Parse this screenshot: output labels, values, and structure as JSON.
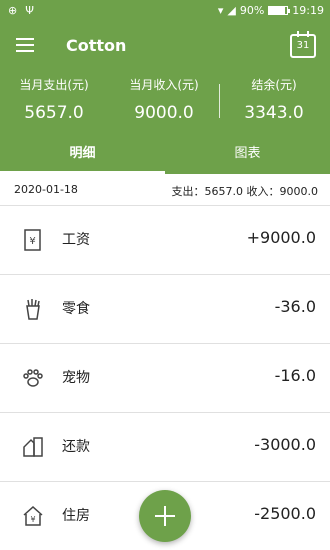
{
  "status": {
    "battery": "90%",
    "time": "19:19",
    "battery_level": 0.9
  },
  "app": {
    "title": "Cotton",
    "calendar_day": "31"
  },
  "summary": {
    "expense_label": "当月支出(元)",
    "expense_value": "5657.0",
    "income_label": "当月收入(元)",
    "income_value": "9000.0",
    "balance_label": "结余(元)",
    "balance_value": "3343.0"
  },
  "tabs": [
    "明细",
    "图表"
  ],
  "day": {
    "date": "2020-01-18",
    "totals": "支出：5657.0 收入：9000.0"
  },
  "records": [
    {
      "label": "工资",
      "amount": "+9000.0",
      "icon": "salary-icon"
    },
    {
      "label": "零食",
      "amount": "-36.0",
      "icon": "snacks-icon"
    },
    {
      "label": "宠物",
      "amount": "-16.0",
      "icon": "pet-paw-icon"
    },
    {
      "label": "还款",
      "amount": "-3000.0",
      "icon": "repayment-icon"
    },
    {
      "label": "住房",
      "amount": "-2500.0",
      "icon": "housing-icon"
    }
  ],
  "colors": {
    "primary": "#6ea14a"
  }
}
